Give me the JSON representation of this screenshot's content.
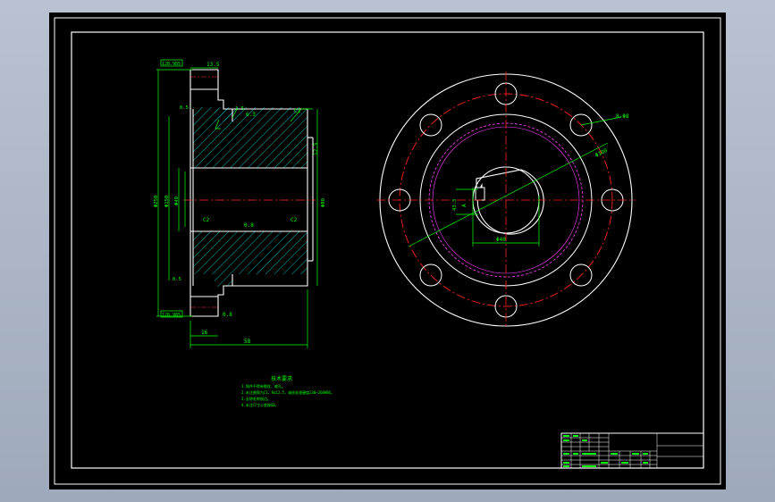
{
  "drawing": {
    "dims": {
      "top_tol": "128.985",
      "top_h": "13.5",
      "chamfer": "1.5",
      "gap_left": "0.5",
      "rough_1": "6.3",
      "c1": "C1",
      "ra_right": "12.5",
      "od_left": "Φ250",
      "d_left2": "Φ150",
      "bore": "Φ40",
      "hub_od": "Φ80",
      "c2": "C2",
      "rough_2": "0.8",
      "c3": "C2",
      "gap_bottom": "0.5",
      "bot_tol": "128.985",
      "rough_3": "0.8",
      "w_16": "16",
      "w_58": "58",
      "pcd": "Φ100",
      "bolt": "8-Φ8",
      "key_w": "Φ40",
      "key_h": "43.3",
      "key_lab": "A"
    },
    "notes": {
      "title": "技术要求",
      "lines": [
        "1.铸件不得有裂纹、缩孔。",
        "2.未注倒角为C1，Ra12.5，调质处理硬度230~260HBS。",
        "3.去除毛刺锐边。",
        "4.未注尺寸公差按GB。"
      ]
    }
  }
}
